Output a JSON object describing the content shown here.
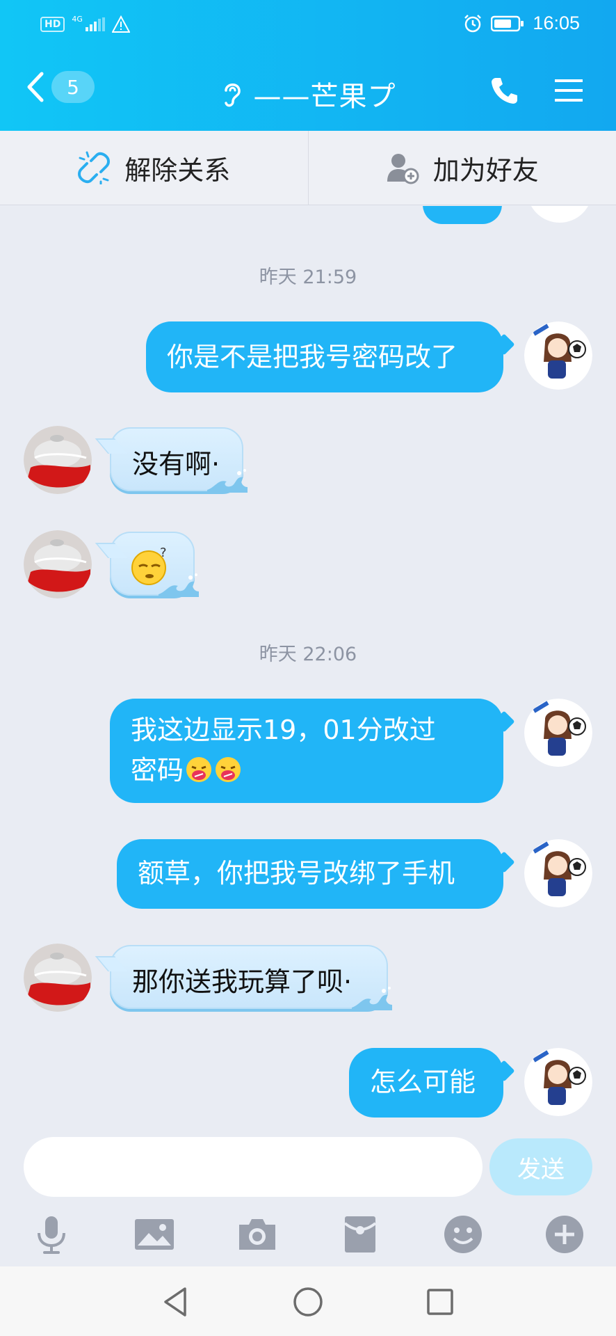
{
  "status_bar": {
    "left_badge": "HD",
    "network": "4G",
    "time": "16:05"
  },
  "nav": {
    "unread_count": "5",
    "title": "——芒果プ"
  },
  "actions": {
    "remove_relation": "解除关系",
    "add_friend": "加为好友"
  },
  "messages": {
    "ts1": "昨天 21:59",
    "m1": "你是不是把我号密码改了",
    "m2": "没有啊·",
    "ts2": "昨天 22:06",
    "m4_line1": "我这边显示19，01分改过",
    "m4_line2": "密码",
    "m5": "额草，你把我号改绑了手机",
    "m6": "那你送我玩算了呗·",
    "m7": "怎么可能"
  },
  "input": {
    "value": "",
    "send_label": "发送"
  },
  "colors": {
    "header_start": "#11c6f6",
    "header_end": "#12a8f0",
    "outgoing_bubble": "#21b5f7",
    "send_disabled": "#b9e9fc"
  },
  "icons": {
    "tools": [
      "microphone-icon",
      "image-icon",
      "camera-icon",
      "red-packet-icon",
      "emoji-icon",
      "plus-icon"
    ],
    "system_nav": [
      "back-triangle-icon",
      "home-circle-icon",
      "recents-square-icon"
    ]
  }
}
